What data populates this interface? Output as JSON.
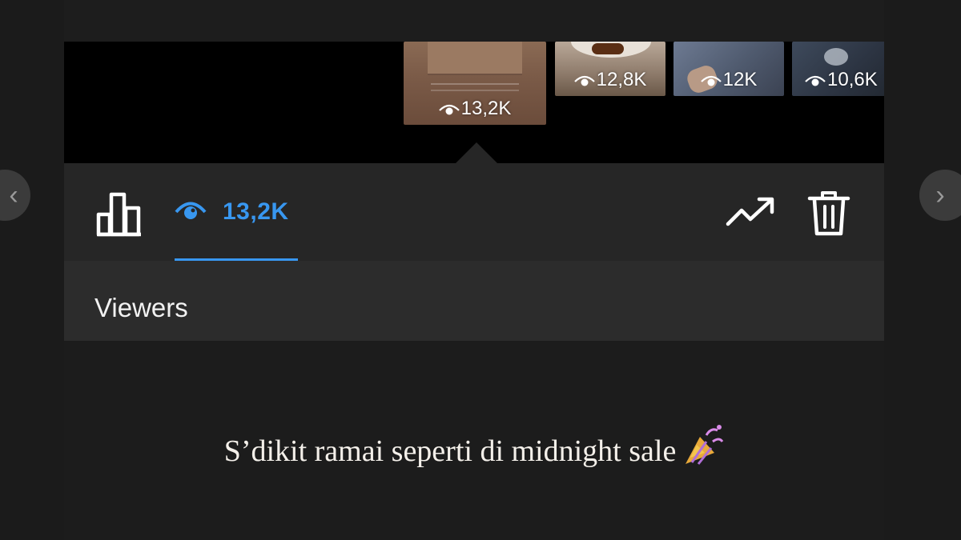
{
  "navigation": {
    "prev_arrow": "‹",
    "next_arrow": "›"
  },
  "story_thumbnails": [
    {
      "views": "13,2K",
      "selected": true
    },
    {
      "views": "12,8K",
      "selected": false
    },
    {
      "views": "12K",
      "selected": false
    },
    {
      "views": "10,6K",
      "selected": false
    }
  ],
  "insights_bar": {
    "stats_icon": "bar-chart-icon",
    "views_tab_icon": "eye-icon",
    "views_count": "13,2K",
    "promote_icon": "trending-up-icon",
    "delete_icon": "trash-icon",
    "accent_color": "#3897f0"
  },
  "viewers_section": {
    "label": "Viewers"
  },
  "story": {
    "caption": "S’dikit ramai seperti di midnight sale",
    "emoji_icon": "party-popper-icon"
  }
}
